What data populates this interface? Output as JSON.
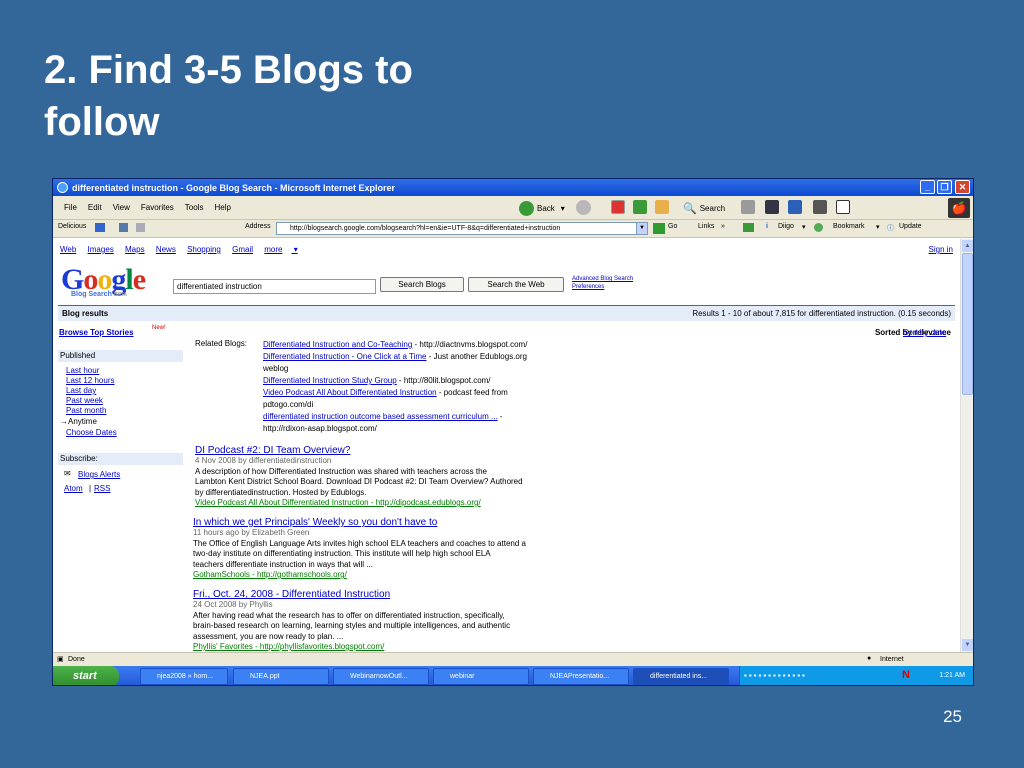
{
  "slide": {
    "title_line1": "2. Find 3-5 Blogs to",
    "title_line2": "follow",
    "page_number": "25"
  },
  "window": {
    "title": "differentiated instruction - Google Blog Search - Microsoft Internet Explorer"
  },
  "menu": [
    "File",
    "Edit",
    "View",
    "Favorites",
    "Tools",
    "Help"
  ],
  "toolbar": {
    "back": "Back",
    "search": "Search"
  },
  "toolbar2": {
    "delicious": "Delicious",
    "address_label": "Address",
    "url": "http://blogsearch.google.com/blogsearch?hl=en&ie=UTF-8&q=differentiated+instruction",
    "go": "Go",
    "links": "Links",
    "diigo": "Diigo",
    "bookmark": "Bookmark",
    "update": "Update"
  },
  "google": {
    "top_links": [
      "Web",
      "Images",
      "Maps",
      "News",
      "Shopping",
      "Gmail",
      "more"
    ],
    "sign_in": "Sign in",
    "logo_sub": "Blog Search",
    "logo_beta": "BETA",
    "query": "differentiated instruction",
    "search_blogs": "Search Blogs",
    "search_web": "Search the Web",
    "advanced": "Advanced Blog Search",
    "preferences": "Preferences",
    "blog_results": "Blog results",
    "results_text": "Results 1 - 10 of about 7,815 for differentiated instruction. (0.15 seconds)",
    "sorted": "Sorted by relevance",
    "sort_date": "Sort by date"
  },
  "sidebar": {
    "browse": "Browse Top Stories",
    "new_badge": "New!",
    "published": "Published",
    "items": [
      "Last hour",
      "Last 12 hours",
      "Last day",
      "Past week",
      "Past month"
    ],
    "anytime": "Anytime",
    "choose": "Choose Dates",
    "subscribe": "Subscribe:",
    "alerts": "Blogs Alerts",
    "atom": "Atom",
    "sep": "|",
    "rss": "RSS"
  },
  "related": {
    "label": "Related Blogs:",
    "entries": [
      {
        "link": "Differentiated Instruction and Co-Teaching",
        "rest": " - http://diactnvms.blogspot.com/"
      },
      {
        "link": "Differentiated Instruction - One Click at a Time",
        "rest": " - Just another Edublogs.org"
      },
      {
        "link": "",
        "rest": "weblog"
      },
      {
        "link": "Differentiated Instruction Study Group",
        "rest": " - http://80lit.blogspot.com/"
      },
      {
        "link": "Video Podcast All About Differentiated Instruction",
        "rest": " - podcast feed from"
      },
      {
        "link": "",
        "rest": "pdtogo.com/di"
      },
      {
        "link": "differentiated instruction outcome based assessment curriculum ...",
        "rest": " -"
      },
      {
        "link": "",
        "rest": "http://rdixon-asap.blogspot.com/"
      }
    ]
  },
  "results": [
    {
      "title": "DI Podcast #2: DI Team Overview?",
      "meta": "4 Nov 2008 by differentiatedinstruction",
      "lines": [
        "A description of how Differentiated Instruction was shared with teachers across the",
        "Lambton Kent District School Board. Download DI Podcast #2: DI Team Overview? Authored",
        "by differentiatedinstruction. Hosted by Edublogs."
      ],
      "source": "Video Podcast All About Differentiated Instruction - http://dipodcast.edublogs.org/"
    },
    {
      "title": "In which we get Principals' Weekly so you don't have to",
      "meta": "11 hours ago by Elizabeth Green",
      "lines": [
        "The Office of English Language Arts invites high school ELA teachers and coaches to attend a",
        "two-day institute on differentiating instruction. This institute will help high school ELA",
        "teachers differentiate instruction in ways that will ..."
      ],
      "source": "GothamSchools - http://gothamschools.org/"
    },
    {
      "title": "Fri., Oct. 24, 2008 - Differentiated Instruction",
      "meta": "24 Oct 2008 by Phyllis",
      "lines": [
        "After having read what the research has to offer on differentiated instruction, specifically,",
        "brain-based research on learning, learning styles and multiple intelligences, and authentic",
        "assessment, you are now ready to plan. ..."
      ],
      "source": "Phyllis' Favorites - http://phyllisfavorites.blogspot.com/"
    }
  ],
  "status": {
    "left": "Done",
    "right": "Internet"
  },
  "taskbar": {
    "start": "start",
    "tasks": [
      "njea2008 » hom...",
      "NJEA.ppt",
      "WebinarnowOutl...",
      "webinar",
      "NJEAPresentatio...",
      "differentiated ins..."
    ],
    "clock": "1:21 AM"
  }
}
